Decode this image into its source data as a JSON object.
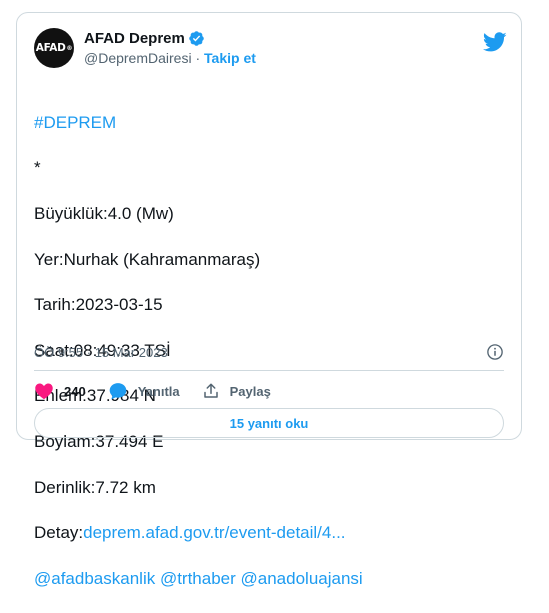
{
  "tweet": {
    "author_name": "AFAD Deprem",
    "avatar_text": "AFAD",
    "handle": "@DepremDairesi",
    "separator": " · ",
    "follow_label": "Takip et",
    "hashtag": "#DEPREM",
    "lines": [
      "*",
      "Büyüklük:4.0 (Mw)",
      "Yer:Nurhak (Kahramanmaraş)",
      "Tarih:2023-03-15",
      "Saat:08:49:33 TSİ",
      "Enlem:37.984 N",
      "Boylam:37.494 E",
      "Derinlik:7.72 km"
    ],
    "detail_label": "Detay:",
    "detail_link": "deprem.afad.gov.tr/event-detail/4...",
    "mentions": "@afadbaskanlik @trthaber @anadoluajansi",
    "timestamp": "ÖÖ 9:55 · 15 Mar 2023",
    "likes": "240",
    "reply_label": "Yanıtla",
    "share_label": "Paylaş",
    "read_replies": "15 yanıtı oku"
  },
  "colors": {
    "accent": "#1d9bf0",
    "like": "#f91880",
    "text": "#0f1419",
    "muted": "#536471"
  }
}
